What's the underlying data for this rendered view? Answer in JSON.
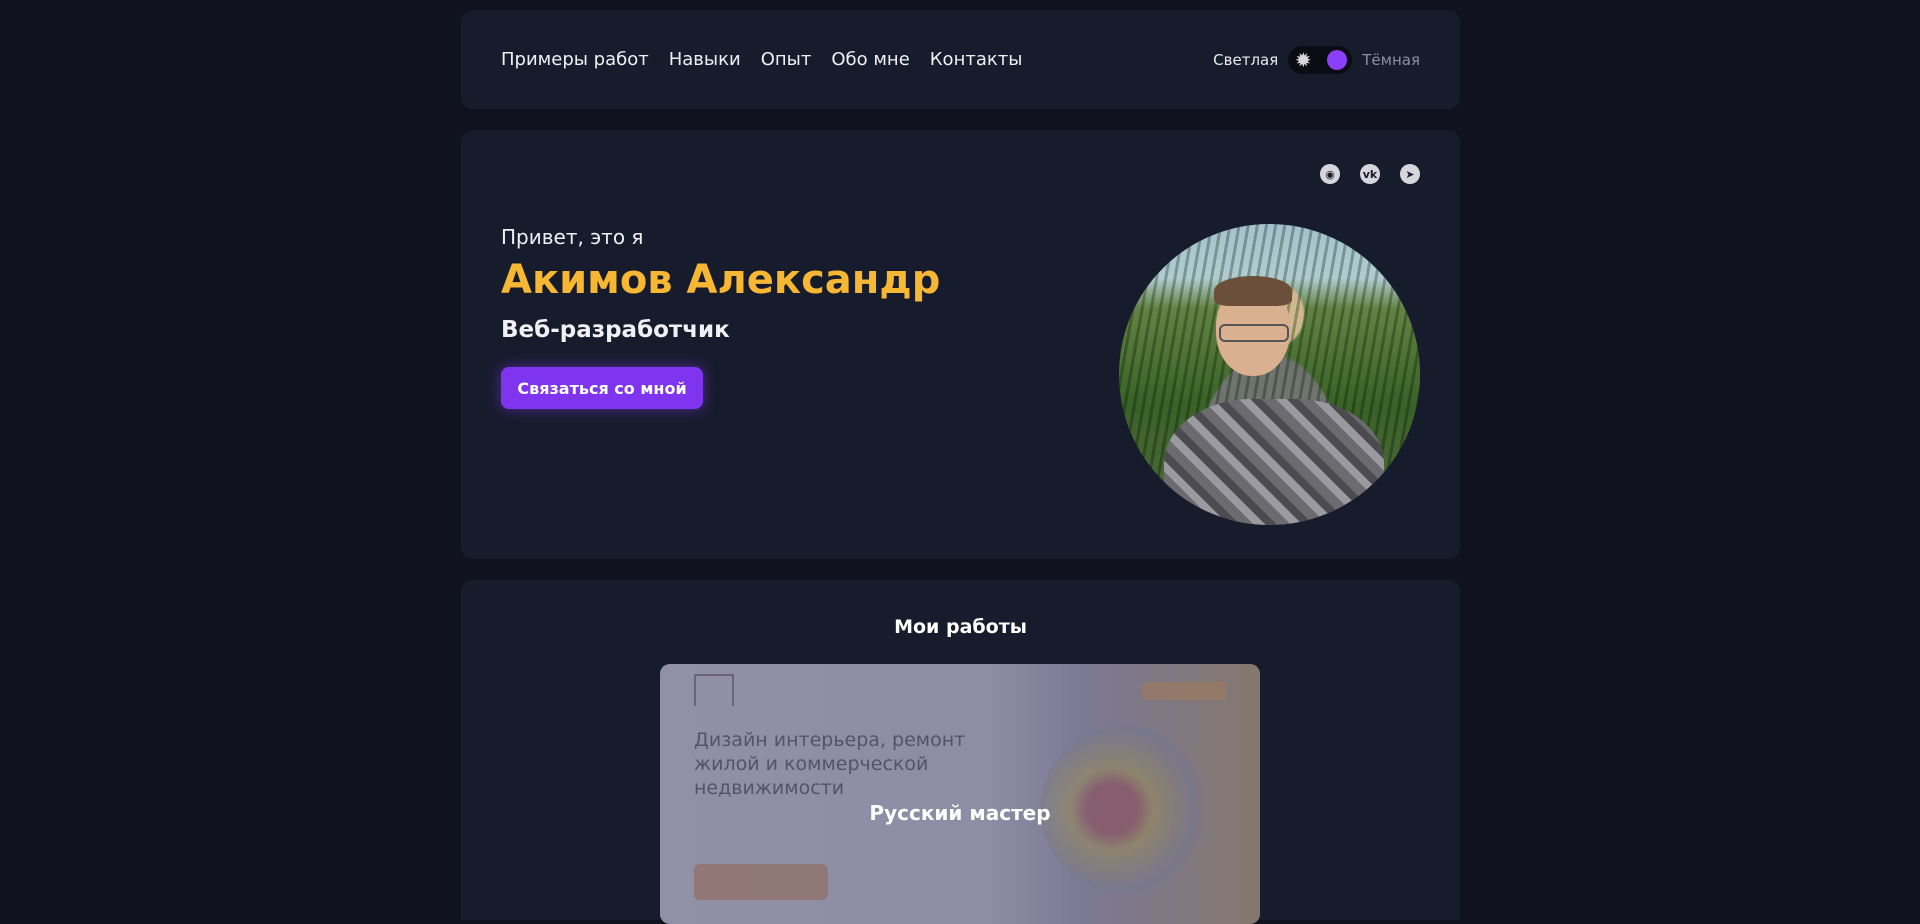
{
  "nav": {
    "items": [
      "Примеры работ",
      "Навыки",
      "Опыт",
      "Обо мне",
      "Контакты"
    ]
  },
  "theme": {
    "light_label": "Светлая",
    "dark_label": "Тёмная",
    "active": "dark"
  },
  "social": [
    "github-icon",
    "vk-icon",
    "telegram-icon"
  ],
  "hero": {
    "greeting": "Привет, это я",
    "name": "Акимов Александр",
    "role": "Веб-разработчик",
    "cta_label": "Связаться со мной"
  },
  "works": {
    "title": "Мои работы",
    "projects": [
      {
        "title": "Русский мастер",
        "preview_heading": "Дизайн интерьера, ремонт жилой и коммерческой недвижимости"
      }
    ]
  },
  "colors": {
    "background": "#10131d",
    "card": "#171c2c",
    "accent_name": "#f7b733",
    "accent_purple": "#7f35f0"
  }
}
